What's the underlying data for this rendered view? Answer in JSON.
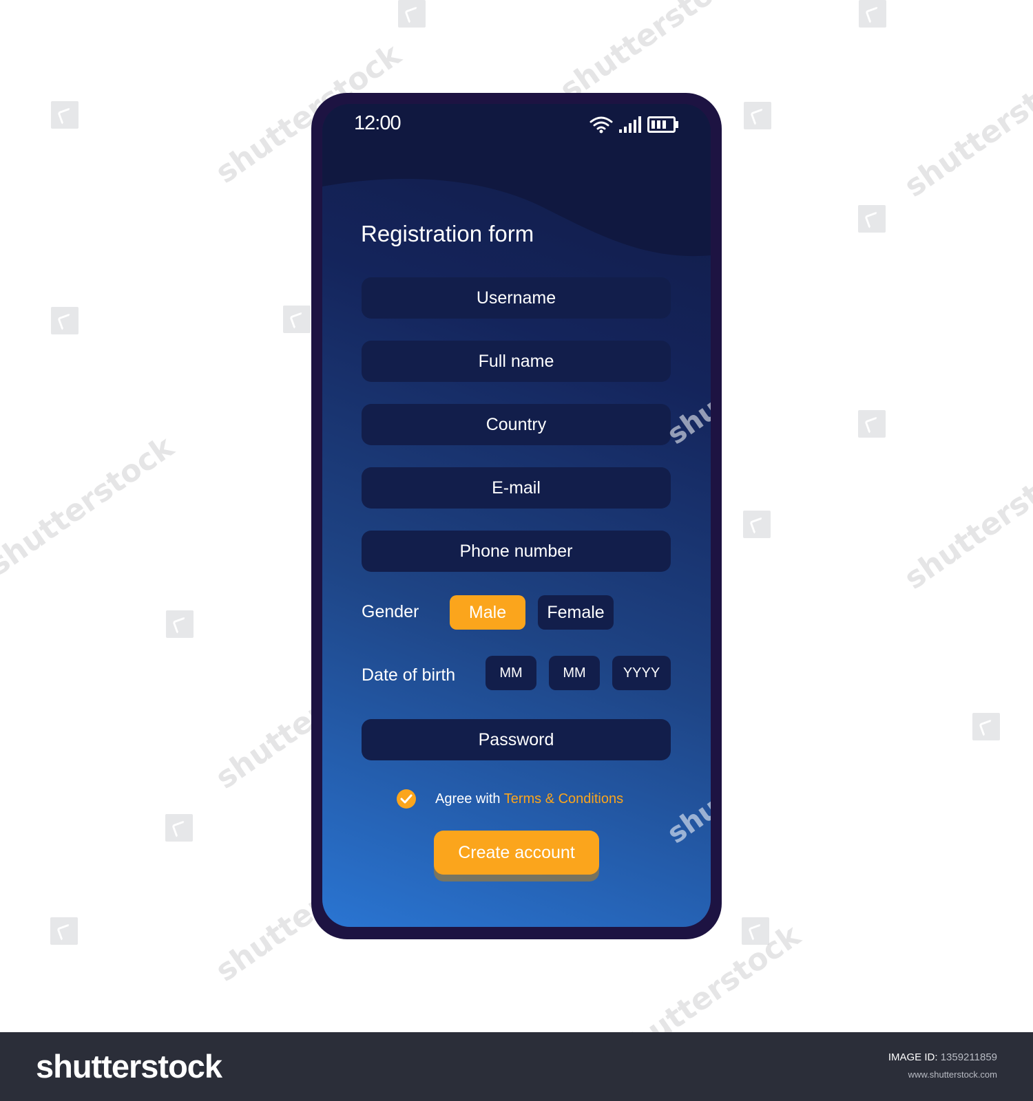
{
  "status_bar": {
    "time": "12:00",
    "icons": [
      "wifi-icon",
      "signal-icon",
      "battery-icon"
    ]
  },
  "form": {
    "title": "Registration form",
    "fields": [
      {
        "placeholder": "Username"
      },
      {
        "placeholder": "Full name"
      },
      {
        "placeholder": "Country"
      },
      {
        "placeholder": "E-mail"
      },
      {
        "placeholder": "Phone number"
      }
    ],
    "gender": {
      "label": "Gender",
      "options": [
        "Male",
        "Female"
      ],
      "selected": "Male"
    },
    "date_of_birth": {
      "label": "Date of birth",
      "placeholders": [
        "MM",
        "MM",
        "YYYY"
      ]
    },
    "password": {
      "placeholder": "Password"
    },
    "agree": {
      "checked": true,
      "prefix": "Agree with",
      "link": "Terms & Conditions"
    },
    "submit_label": "Create account"
  },
  "colors": {
    "accent": "#fba51c",
    "field_background": "#121e4b",
    "phone_frame": "#1d1342",
    "gradient_top": "#111a43",
    "gradient_bottom": "#2a75d2"
  },
  "watermark": {
    "text": "shutterstock",
    "footer_logo": "shutterstock",
    "image_id_label": "IMAGE ID:",
    "image_id": "1359211859",
    "url": "www.shutterstock.com"
  }
}
